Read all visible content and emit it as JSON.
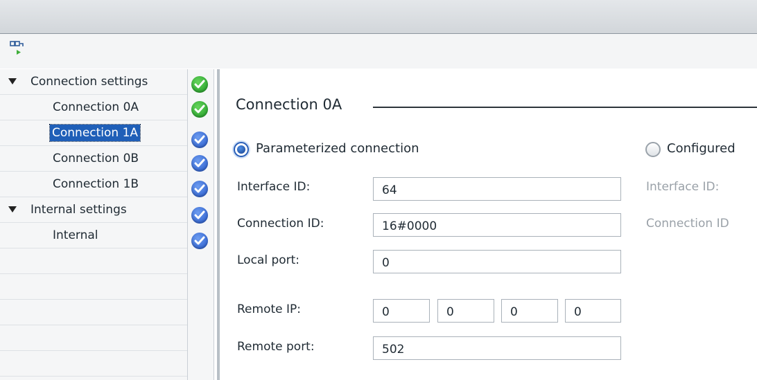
{
  "toolbar": {
    "icon": "connection-run-icon"
  },
  "nav": {
    "items": [
      {
        "label": "Connection settings",
        "level": 1,
        "expanded": true,
        "status": "green"
      },
      {
        "label": "Connection 0A",
        "level": 2,
        "status": "green"
      },
      {
        "label": "Connection 1A",
        "level": 2,
        "selected": true,
        "status": "blue"
      },
      {
        "label": "Connection 0B",
        "level": 2,
        "status": "blue"
      },
      {
        "label": "Connection 1B",
        "level": 2,
        "status": "blue"
      },
      {
        "label": "Internal settings",
        "level": 1,
        "expanded": true,
        "status": "blue"
      },
      {
        "label": "Internal",
        "level": 2,
        "status": "blue"
      }
    ]
  },
  "section": {
    "title": "Connection 0A"
  },
  "options": {
    "parameterized": {
      "label": "Parameterized connection",
      "selected": true
    },
    "configured": {
      "label": "Configured",
      "selected": false
    }
  },
  "fields": {
    "interface_id": {
      "label": "Interface ID:",
      "value": "64"
    },
    "connection_id": {
      "label": "Connection ID:",
      "value": "16#0000"
    },
    "local_port": {
      "label": "Local port:",
      "value": "0"
    },
    "remote_ip": {
      "label": "Remote IP:",
      "octets": [
        "0",
        "0",
        "0",
        "0"
      ]
    },
    "remote_port": {
      "label": "Remote port:",
      "value": "502"
    }
  },
  "configured_fields": {
    "interface_id_label": "Interface ID:",
    "connection_id_label": "Connection ID"
  },
  "colors": {
    "selection": "#1f5fb8",
    "status_ok": "#1c9a24",
    "status_info": "#2356c9"
  }
}
